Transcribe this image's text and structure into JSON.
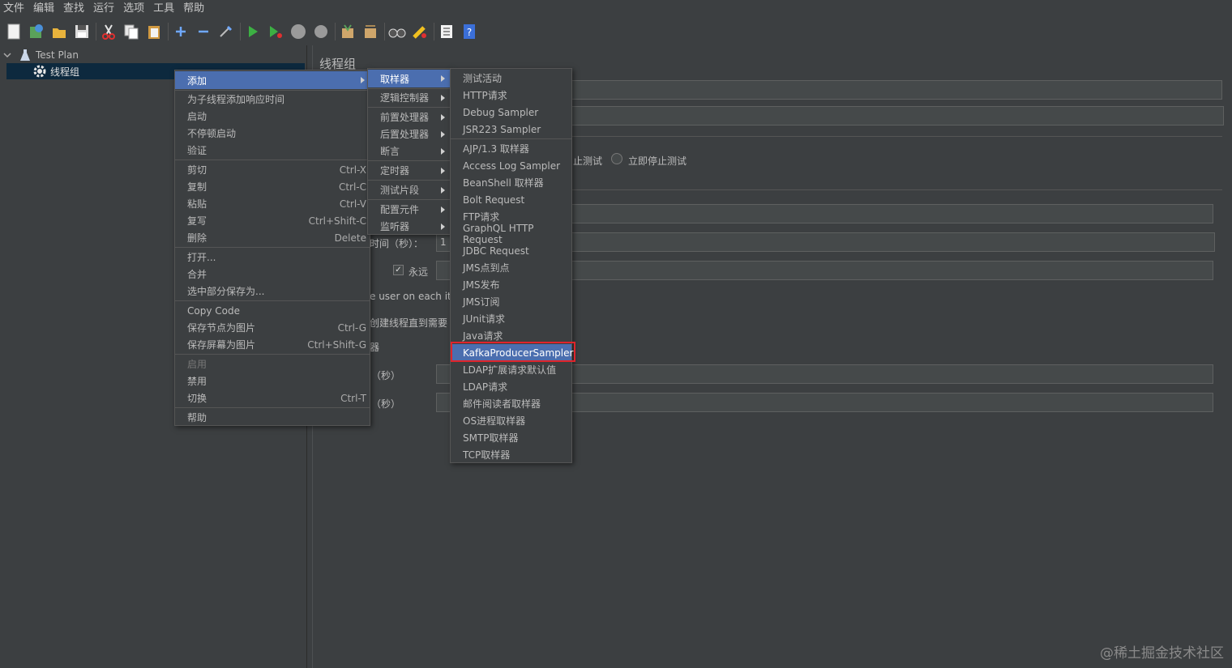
{
  "menubar": [
    "文件",
    "编辑",
    "查找",
    "运行",
    "选项",
    "工具",
    "帮助"
  ],
  "tree": {
    "root": "Test Plan",
    "child": "线程组"
  },
  "panel": {
    "title": "线程组",
    "stop_test_label": "止测试",
    "stop_now_label": "立即停止测试",
    "ramp_label": "时间（秒）：",
    "ramp_value": "1",
    "forever_label": "永远",
    "same_user_label": "e user on each itera",
    "delay_create_label": "创建线程直到需要",
    "scheduler_label": "器",
    "duration_label": "（秒）",
    "startup_delay_label": "（秒）"
  },
  "context_menu": {
    "items": [
      {
        "label": "添加",
        "submenu": true
      },
      {
        "label": "为子线程添加响应时间"
      },
      {
        "label": "启动"
      },
      {
        "label": "不停顿启动"
      },
      {
        "label": "验证"
      },
      {
        "label": "剪切",
        "accel": "Ctrl-X"
      },
      {
        "label": "复制",
        "accel": "Ctrl-C"
      },
      {
        "label": "粘贴",
        "accel": "Ctrl-V"
      },
      {
        "label": "复写",
        "accel": "Ctrl+Shift-C"
      },
      {
        "label": "删除",
        "accel": "Delete"
      },
      {
        "label": "打开..."
      },
      {
        "label": "合并"
      },
      {
        "label": "选中部分保存为..."
      },
      {
        "label": "Copy Code"
      },
      {
        "label": "保存节点为图片",
        "accel": "Ctrl-G"
      },
      {
        "label": "保存屏幕为图片",
        "accel": "Ctrl+Shift-G"
      },
      {
        "label": "启用"
      },
      {
        "label": "禁用"
      },
      {
        "label": "切换",
        "accel": "Ctrl-T"
      },
      {
        "label": "帮助"
      }
    ]
  },
  "add_menu": {
    "items": [
      "取样器",
      "逻辑控制器",
      "前置处理器",
      "后置处理器",
      "断言",
      "定时器",
      "测试片段",
      "配置元件",
      "监听器"
    ]
  },
  "sampler_menu": {
    "items": [
      "测试活动",
      "HTTP请求",
      "Debug Sampler",
      "JSR223 Sampler",
      "AJP/1.3 取样器",
      "Access Log Sampler",
      "BeanShell 取样器",
      "Bolt Request",
      "FTP请求",
      "GraphQL HTTP Request",
      "JDBC Request",
      "JMS点到点",
      "JMS发布",
      "JMS订阅",
      "JUnit请求",
      "Java请求",
      "KafkaProducerSampler",
      "LDAP扩展请求默认值",
      "LDAP请求",
      "邮件阅读者取样器",
      "OS进程取样器",
      "SMTP取样器",
      "TCP取样器"
    ]
  },
  "watermark": "@稀土掘金技术社区",
  "colors": {
    "background": "#3c3f41",
    "highlight": "#4b6eaf",
    "annotation": "#e0242b"
  }
}
